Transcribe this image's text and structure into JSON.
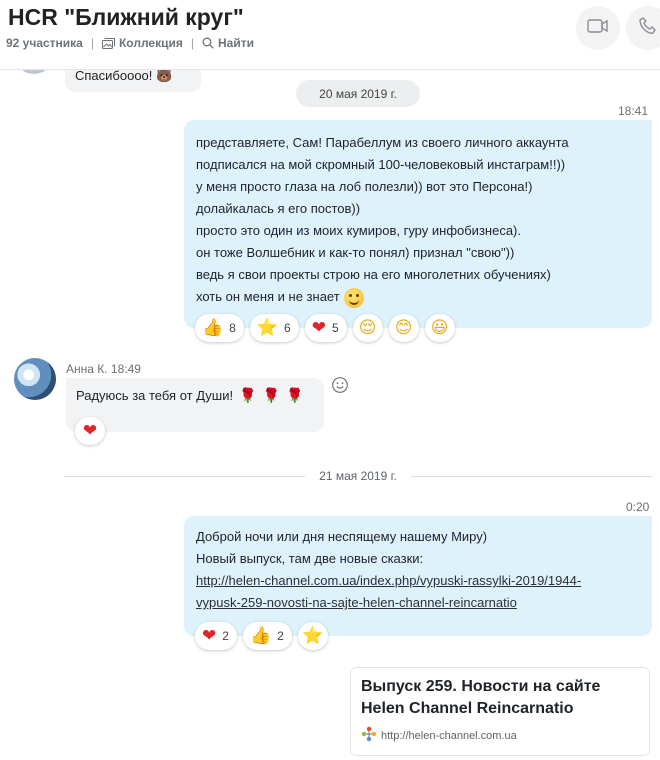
{
  "header": {
    "title": "HCR \"Ближний круг\"",
    "participants": "92 участника",
    "collection_label": "Коллекция",
    "find_label": "Найти",
    "separator": "|"
  },
  "messages": {
    "top_partial": {
      "text": "Спасибоооо! 🐻"
    },
    "date1": "20 мая 2019 г.",
    "out1": {
      "time": "18:41",
      "lines": [
        "представляете, Сам! Парабеллум из своего личного аккаунта",
        "подписался на мой скромный 100-человековый инстаграм!!))",
        "у меня просто глаза на лоб полезли)) вот это Персона!)",
        "долайкалась я его постов))",
        "просто это один из моих кумиров, гуру инфобизнеса).",
        "он тоже Волшебник и как-то понял)  признал \"свою\"))",
        "ведь я свои проекты строю на его многолетних обучениях)",
        "хоть он меня и не знает"
      ],
      "reactions": [
        {
          "icon": "👍",
          "count": "8"
        },
        {
          "icon": "⭐",
          "count": "6"
        },
        {
          "icon": "❤",
          "count": "5"
        },
        {
          "icon": "😌"
        },
        {
          "icon": "😊"
        },
        {
          "icon": "😃"
        }
      ]
    },
    "in1": {
      "sender": "Анна К. 18:49",
      "text": "Радуюсь за тебя от Души!",
      "roses": [
        "🌹",
        "🌹",
        "🌹"
      ],
      "reaction": "❤"
    },
    "date2": "21 мая 2019 г.",
    "out2": {
      "time": "0:20",
      "line1": "Доброй ночи или дня неспящему нашему Миру)",
      "line2": "Новый выпуск, там две новые сказки:",
      "link1": "http://helen-channel.com.ua/index.php/vypuski-rassylki-2019/1944-",
      "link2": "vypusk-259-novosti-na-sajte-helen-channel-reincarnatio",
      "reactions": [
        {
          "icon": "❤",
          "count": "2"
        },
        {
          "icon": "👍",
          "count": "2"
        },
        {
          "icon": "⭐"
        }
      ]
    },
    "preview": {
      "title1": "Выпуск 259. Новости на сайте",
      "title2": "Helen Channel Reincarnatio",
      "url": "http://helen-channel.com.ua"
    }
  },
  "colors": {
    "outgoing_bubble": "#def2fc",
    "incoming_bubble": "#f2f3f5",
    "heart": "#e0242a",
    "star": "#f4b400"
  }
}
